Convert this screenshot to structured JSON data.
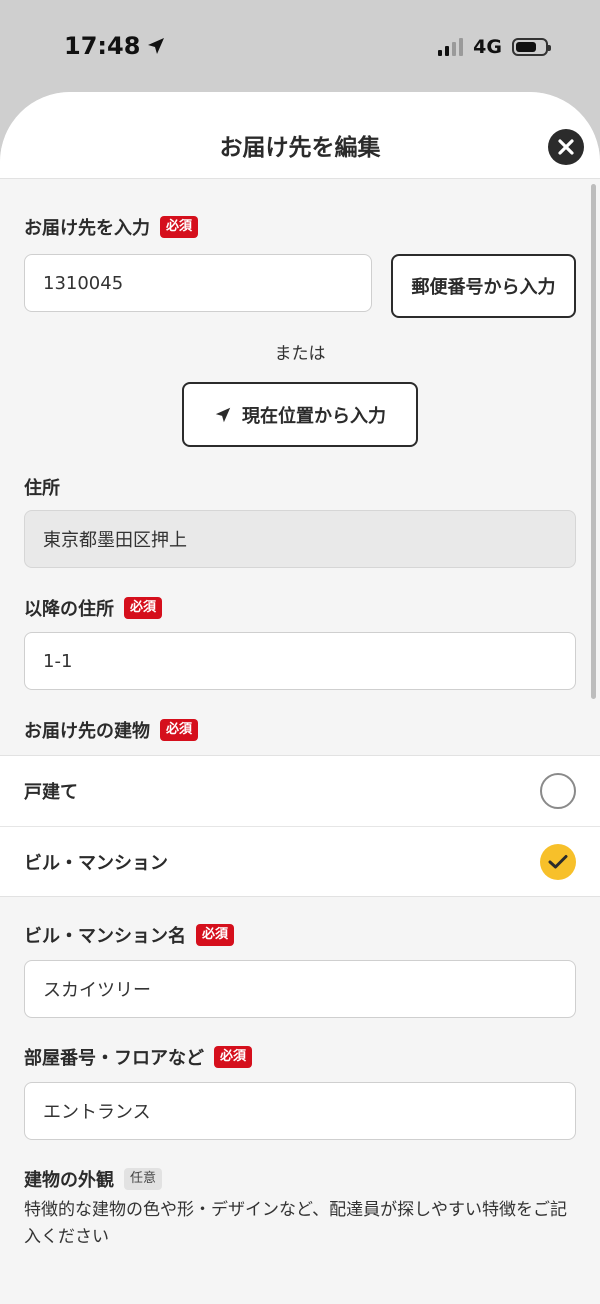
{
  "status_bar": {
    "time": "17:48",
    "network": "4G"
  },
  "header": {
    "title": "お届け先を編集"
  },
  "delivery_input": {
    "label": "お届け先を入力",
    "badge": "必須",
    "postal_value": "1310045",
    "postal_button": "郵便番号から入力",
    "or_text": "または",
    "location_button": "現在位置から入力"
  },
  "address": {
    "label": "住所",
    "value": "東京都墨田区押上"
  },
  "address_detail": {
    "label": "以降の住所",
    "badge": "必須",
    "value": "1-1"
  },
  "building_type": {
    "label": "お届け先の建物",
    "badge": "必須",
    "options": [
      {
        "label": "戸建て",
        "selected": false
      },
      {
        "label": "ビル・マンション",
        "selected": true
      }
    ]
  },
  "building_name": {
    "label": "ビル・マンション名",
    "badge": "必須",
    "value": "スカイツリー"
  },
  "room_number": {
    "label": "部屋番号・フロアなど",
    "badge": "必須",
    "value": "エントランス"
  },
  "appearance": {
    "label": "建物の外観",
    "badge": "任意",
    "description": "特徴的な建物の色や形・デザインなど、配達員が探しやすい特徴をご記入ください"
  },
  "colors": {
    "required": "#d50f1c",
    "selected": "#f7c02a",
    "text": "#2b2b2b"
  },
  "icons": [
    "location-arrow-icon",
    "close-icon",
    "check-icon",
    "signal-icon",
    "battery-icon",
    "navigation-icon"
  ]
}
